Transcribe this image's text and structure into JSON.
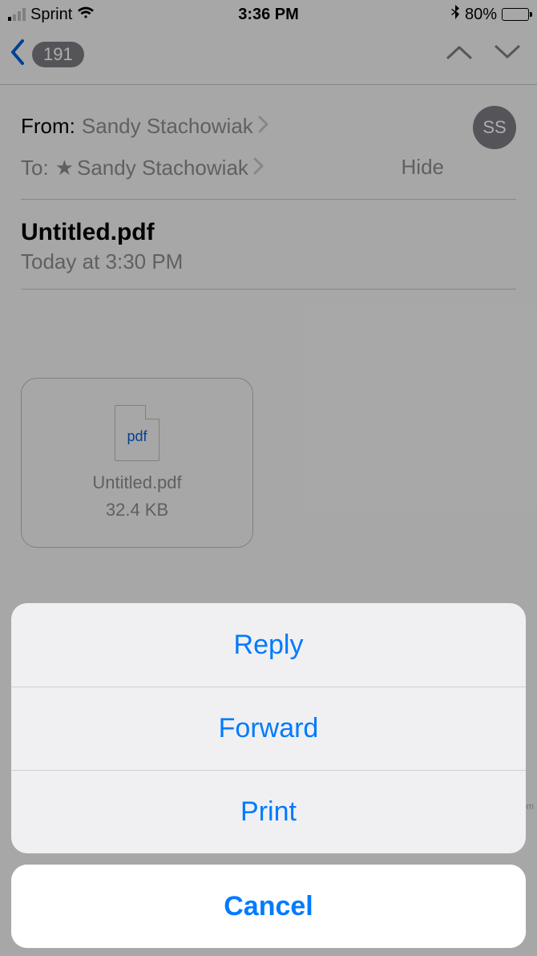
{
  "status": {
    "carrier": "Sprint",
    "time": "3:36 PM",
    "battery_pct": "80%",
    "battery_fill": 80
  },
  "nav": {
    "badge": "191"
  },
  "email": {
    "from_label": "From:",
    "from_name": "Sandy Stachowiak",
    "to_label": "To:",
    "to_name": "Sandy Stachowiak",
    "hide": "Hide",
    "initials": "SS",
    "subject": "Untitled.pdf",
    "date": "Today at 3:30 PM"
  },
  "attachment": {
    "ext": "pdf",
    "name": "Untitled.pdf",
    "size": "32.4 KB"
  },
  "sheet": {
    "reply": "Reply",
    "forward": "Forward",
    "print": "Print",
    "cancel": "Cancel"
  },
  "watermark": "www.frfam.com"
}
